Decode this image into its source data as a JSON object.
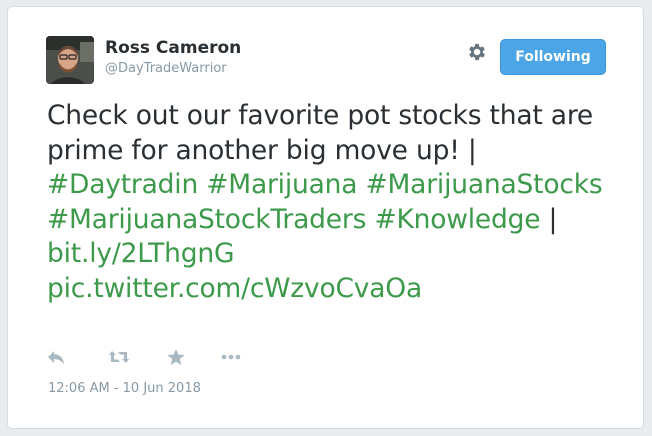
{
  "author": {
    "name": "Ross Cameron",
    "handle": "@DayTradeWarrior"
  },
  "follow_button": {
    "label": "Following"
  },
  "tweet": {
    "text_part1": "Check out our favorite pot stocks that are prime for another big move up! | ",
    "tag1": "#Daytradin",
    "tag2": "#Marijuana",
    "tag3": "#MarijuanaStocks",
    "tag4": "#MarijuanaStockTraders",
    "tag5": "#Knowledge",
    "sep": " | ",
    "link1": "bit.ly/2LThgnG",
    "link2": "pic.twitter.com/cWzvoCvaOa"
  },
  "actions": [
    {
      "icon": "reply-icon"
    },
    {
      "icon": "retweet-icon"
    },
    {
      "icon": "favorite-star-icon"
    },
    {
      "icon": "more-options-icon"
    }
  ],
  "timestamp": "12:06 AM - 10 Jun 2018",
  "colors": {
    "hashtag": "#3c9a4a",
    "follow_button": "#4ca5e6",
    "secondary_text": "#8899a6",
    "icon": "#aab8c2"
  }
}
